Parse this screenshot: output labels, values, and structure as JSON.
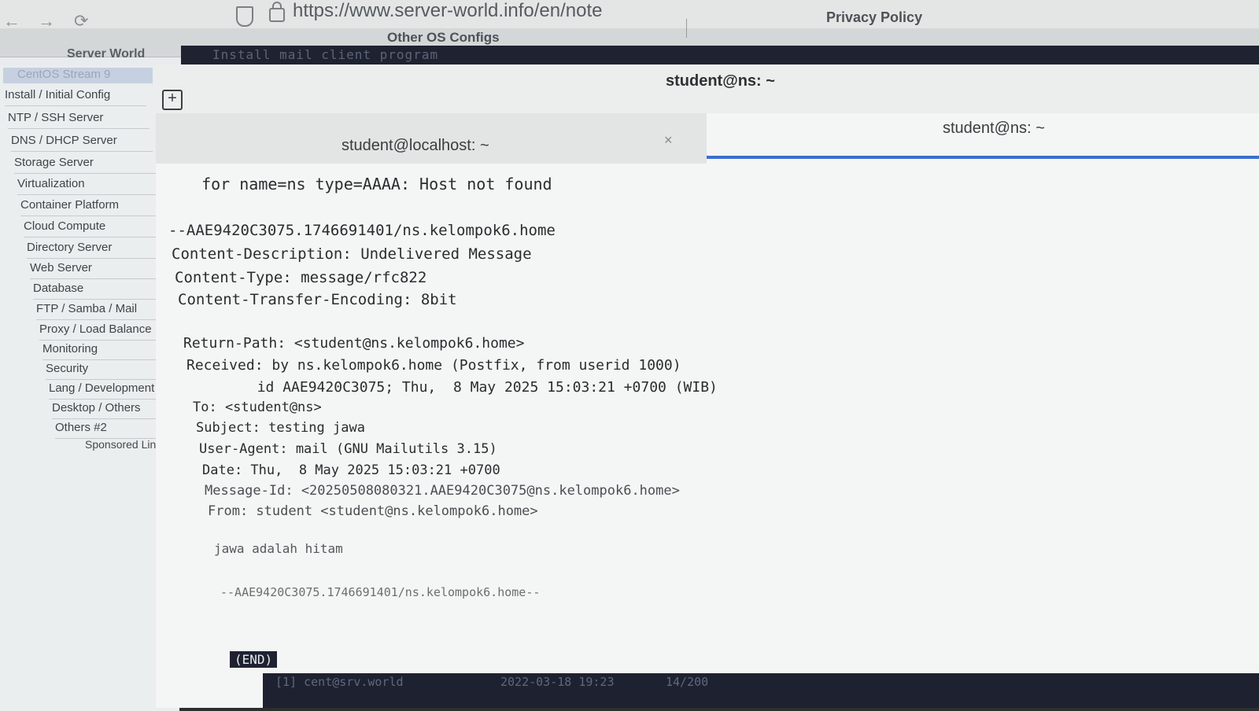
{
  "browser": {
    "back_icon": "←",
    "forward_icon": "→",
    "reload_icon": "⟳",
    "url": "https://www.server-world.info/en/note"
  },
  "site": {
    "title": "Server World",
    "other_configs": "Other OS Configs",
    "privacy": "Privacy Policy",
    "section_bar": "Install mail client program"
  },
  "sidebar": {
    "top": "CentOS Stream 9",
    "items": [
      "Install / Initial Config",
      "NTP / SSH Server",
      "DNS / DHCP Server",
      "Storage Server",
      "Virtualization",
      "Container Platform",
      "Cloud Compute",
      "Directory Server",
      "Web Server",
      "Database",
      "FTP / Samba / Mail",
      "Proxy / Load Balance",
      "Monitoring",
      "Security",
      "Lang / Development",
      "Desktop / Others",
      "Others #2"
    ],
    "sponsored": "Sponsored Link"
  },
  "terminal": {
    "window_title": "student@ns: ~",
    "new_tab_icon": "+",
    "tabs": [
      {
        "label": "student@localhost: ~",
        "close": "×"
      },
      {
        "label": "student@ns: ~"
      }
    ],
    "lines": [
      "  for name=ns type=AAAA: Host not found",
      "",
      "--AAE9420C3075.1746691401/ns.kelompok6.home",
      "Content-Description: Undelivered Message",
      "Content-Type: message/rfc822",
      "Content-Transfer-Encoding: 8bit",
      "",
      "Return-Path: <student@ns.kelompok6.home>",
      "Received: by ns.kelompok6.home (Postfix, from userid 1000)",
      "        id AAE9420C3075; Thu,  8 May 2025 15:03:21 +0700 (WIB)",
      "To: <student@ns>",
      "Subject: testing jawa",
      "User-Agent: mail (GNU Mailutils 3.15)",
      "Date: Thu,  8 May 2025 15:03:21 +0700",
      "Message-Id: <20250508080321.AAE9420C3075@ns.kelompok6.home>",
      "From: student <student@ns.kelompok6.home>",
      "",
      "jawa adalah hitam",
      "",
      "--AAE9420C3075.1746691401/ns.kelompok6.home--"
    ],
    "end_marker": "(END)"
  },
  "bottom_bar": {
    "left": "[1] cent@srv.world",
    "right": "2022-03-18 19:23",
    "extra": "14/200"
  }
}
